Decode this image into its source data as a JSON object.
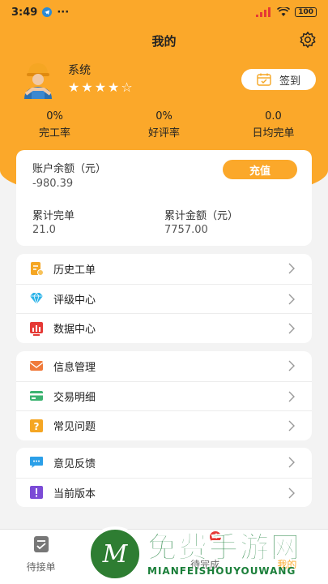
{
  "status_bar": {
    "time": "3:49",
    "battery": "100"
  },
  "header": {
    "title": "我的"
  },
  "profile": {
    "name": "系统",
    "rating": 4.5,
    "signin_label": "签到"
  },
  "stats": [
    {
      "value": "0%",
      "label": "完工率"
    },
    {
      "value": "0%",
      "label": "好评率"
    },
    {
      "value": "0.0",
      "label": "日均完单"
    }
  ],
  "balance": {
    "balance_label": "账户余额（元）",
    "balance_value": "-980.39",
    "recharge_label": "充值",
    "orders_label": "累计完单",
    "orders_value": "21.0",
    "amount_label": "累计金额（元）",
    "amount_value": "7757.00"
  },
  "menu_groups": [
    [
      {
        "label": "历史工单",
        "icon": "history-orders-icon",
        "color": "#f5a623"
      },
      {
        "label": "评级中心",
        "icon": "diamond-icon",
        "color": "#2bb3e8"
      },
      {
        "label": "数据中心",
        "icon": "data-chart-icon",
        "color": "#e53935"
      }
    ],
    [
      {
        "label": "信息管理",
        "icon": "envelope-icon",
        "color": "#f07a3a"
      },
      {
        "label": "交易明细",
        "icon": "card-icon",
        "color": "#3cb371"
      },
      {
        "label": "常见问题",
        "icon": "question-icon",
        "color": "#f5a623"
      }
    ],
    [
      {
        "label": "意见反馈",
        "icon": "feedback-icon",
        "color": "#2b9fe8"
      },
      {
        "label": "当前版本",
        "icon": "version-icon",
        "color": "#7b4bd6"
      }
    ]
  ],
  "tabbar": {
    "tabs": [
      {
        "label": "待接单"
      },
      {
        "label": ""
      },
      {
        "label": "待完成",
        "badge": "4"
      },
      {
        "label": "我的"
      }
    ]
  },
  "watermark": {
    "main": "免费手游网",
    "sub": "MIANFEISHOUYOUWANG",
    "logo_letter": "M"
  },
  "colors": {
    "accent": "#fba82a",
    "background": "#f3f3f3"
  }
}
